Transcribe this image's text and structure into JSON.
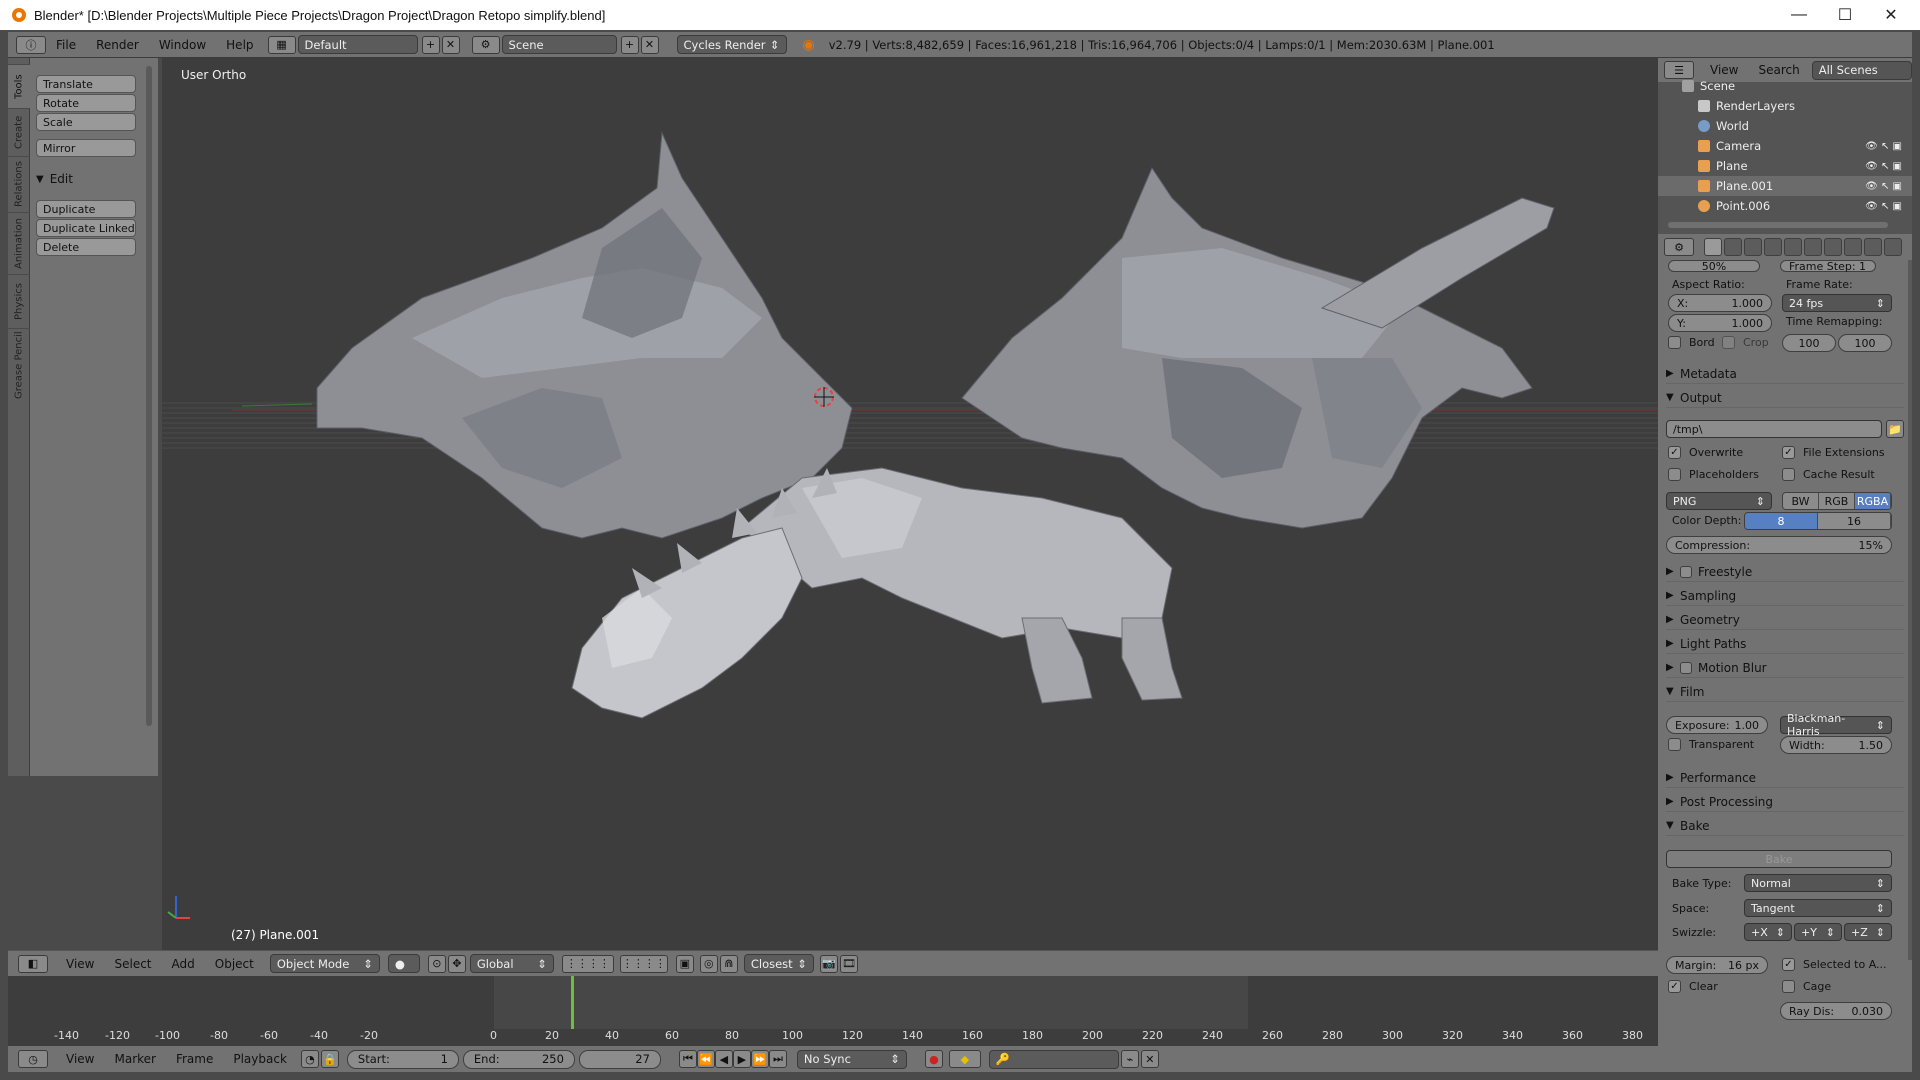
{
  "window": {
    "title": "Blender* [D:\\Blender Projects\\Multiple Piece Projects\\Dragon Project\\Dragon Retopo simplify.blend]",
    "controls": {
      "minimize": "—",
      "maximize": "☐",
      "close": "✕"
    }
  },
  "info_header": {
    "menus": [
      "File",
      "Render",
      "Window",
      "Help"
    ],
    "layout": "Default",
    "scene": "Scene",
    "render_engine": "Cycles Render",
    "stats": "v2.79 | Verts:8,482,659 | Faces:16,961,218 | Tris:16,964,706 | Objects:0/4 | Lamps:0/1 | Mem:2030.63M | Plane.001"
  },
  "toolshelf": {
    "tabs": [
      "Tools",
      "Create",
      "Relations",
      "Animation",
      "Physics",
      "Grease Pencil"
    ],
    "transform_buttons": [
      "Translate",
      "Rotate",
      "Scale"
    ],
    "mirror_button": "Mirror",
    "edit_panel": {
      "title": "Edit",
      "buttons": [
        "Duplicate",
        "Duplicate Linked",
        "Delete"
      ]
    }
  },
  "viewport": {
    "view_label": "User Ortho",
    "object_info": "(27) Plane.001",
    "header": {
      "menus": [
        "View",
        "Select",
        "Add",
        "Object"
      ],
      "mode": "Object Mode",
      "orientation": "Global",
      "snap": "Closest"
    }
  },
  "timeline": {
    "ruler_ticks": [
      "-140",
      "-120",
      "-100",
      "-80",
      "-60",
      "-40",
      "-20",
      "0",
      "20",
      "40",
      "60",
      "80",
      "100",
      "120",
      "140",
      "160",
      "180",
      "200",
      "220",
      "240",
      "260",
      "280",
      "300",
      "320",
      "340",
      "360",
      "380"
    ],
    "current_frame_value": 27,
    "footer": {
      "menus": [
        "View",
        "Marker",
        "Frame",
        "Playback"
      ],
      "start_label": "Start:",
      "start": "1",
      "end_label": "End:",
      "end": "250",
      "current": "27",
      "sync": "No Sync"
    }
  },
  "outliner": {
    "header": {
      "view": "View",
      "search": "Search",
      "filter": "All Scenes"
    },
    "items": [
      {
        "label": "Scene",
        "icon_color": "#a0a0a0"
      },
      {
        "label": "RenderLayers",
        "icon_color": "#c8c8c8"
      },
      {
        "label": "World",
        "icon_color": "#7a9ac8"
      },
      {
        "label": "Camera",
        "icon_color": "#e8a050"
      },
      {
        "label": "Plane",
        "icon_color": "#e8a050"
      },
      {
        "label": "Plane.001",
        "icon_color": "#e8a050"
      },
      {
        "label": "Point.006",
        "icon_color": "#e8a050"
      }
    ]
  },
  "properties": {
    "top_partial": {
      "percent": "50%",
      "frame_step": "Frame Step: 1"
    },
    "aspect_ratio": {
      "label": "Aspect Ratio:",
      "x_label": "X:",
      "x": "1.000",
      "y_label": "Y:",
      "y": "1.000"
    },
    "frame_rate": {
      "label": "Frame Rate:",
      "value": "24 fps"
    },
    "time_remapping": {
      "label": "Time Remapping:",
      "old": "100",
      "new": "100"
    },
    "bord": "Bord",
    "crop": "Crop",
    "metadata": "Metadata",
    "output": {
      "title": "Output",
      "path": "/tmp\\",
      "overwrite": "Overwrite",
      "file_extensions": "File Extensions",
      "placeholders": "Placeholders",
      "cache_result": "Cache Result",
      "format": "PNG",
      "color_modes": [
        "BW",
        "RGB",
        "RGBA"
      ],
      "color_depth_label": "Color Depth:",
      "color_depths": [
        "8",
        "16"
      ],
      "compression_label": "Compression:",
      "compression": "15%"
    },
    "sections_collapsed": [
      "Freestyle",
      "Sampling",
      "Geometry",
      "Light Paths",
      "Motion Blur"
    ],
    "film": {
      "title": "Film",
      "exposure_label": "Exposure:",
      "exposure": "1.00",
      "filter": "Blackman-Harris",
      "transparent": "Transparent",
      "width_label": "Width:",
      "width": "1.50"
    },
    "performance": "Performance",
    "post_processing": "Post Processing",
    "bake": {
      "title": "Bake",
      "bake_button": "Bake",
      "bake_type_label": "Bake Type:",
      "bake_type": "Normal",
      "space_label": "Space:",
      "space": "Tangent",
      "swizzle_label": "Swizzle:",
      "swizzle": [
        "+X",
        "+Y",
        "+Z"
      ],
      "margin_label": "Margin:",
      "margin": "16 px",
      "selected_to_active": "Selected to A...",
      "clear": "Clear",
      "cage": "Cage",
      "ray_dis_label": "Ray Dis:",
      "ray_dis": "0.030"
    }
  },
  "colors": {
    "accent_blue": "#5680c2",
    "panel": "#727272",
    "viewport": "#3d3d3d",
    "timeline_cursor": "#6fbf3f"
  }
}
